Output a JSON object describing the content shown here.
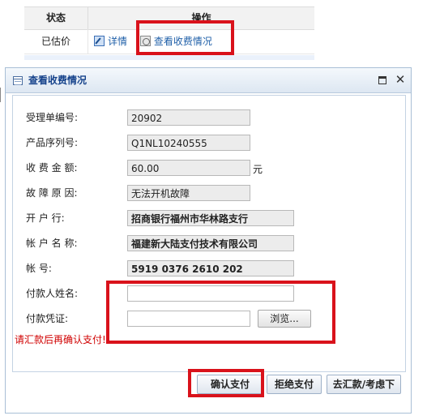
{
  "table": {
    "col_status": "状态",
    "col_action": "操作",
    "row": {
      "status": "已估价",
      "detail_link": "详情",
      "view_fee_link": "查看收费情况"
    }
  },
  "dialog": {
    "title": "查看收费情况",
    "fields": {
      "order_no": {
        "label": "受理单编号:",
        "value": "20902"
      },
      "serial_no": {
        "label": "产品序列号:",
        "value": "Q1NL10240555"
      },
      "fee_amount": {
        "label": "收 费 金 额:",
        "value": "60.00",
        "unit": "元"
      },
      "fault_reason": {
        "label": "故 障 原 因:",
        "value": "无法开机故障"
      },
      "bank": {
        "label": "开 户  行:",
        "value": "招商银行福州市华林路支行"
      },
      "account_name": {
        "label": "帐 户 名 称:",
        "value": "福建新大陆支付技术有限公司"
      },
      "account_no": {
        "label": "帐    号:",
        "value": "5919 0376 2610 202"
      },
      "payer_name": {
        "label": "付款人姓名:",
        "value": ""
      },
      "payment_voucher": {
        "label": "付款凭证:",
        "value": "",
        "browse_label": "浏览..."
      }
    },
    "warning": "请汇款后再确认支付!",
    "buttons": {
      "confirm": "确认支付",
      "reject": "拒绝支付",
      "later": "去汇款/考虑下"
    }
  },
  "colors": {
    "highlight": "#d9121b",
    "title_text": "#15428b",
    "warning": "#d00000",
    "link": "#1f5fa8"
  }
}
